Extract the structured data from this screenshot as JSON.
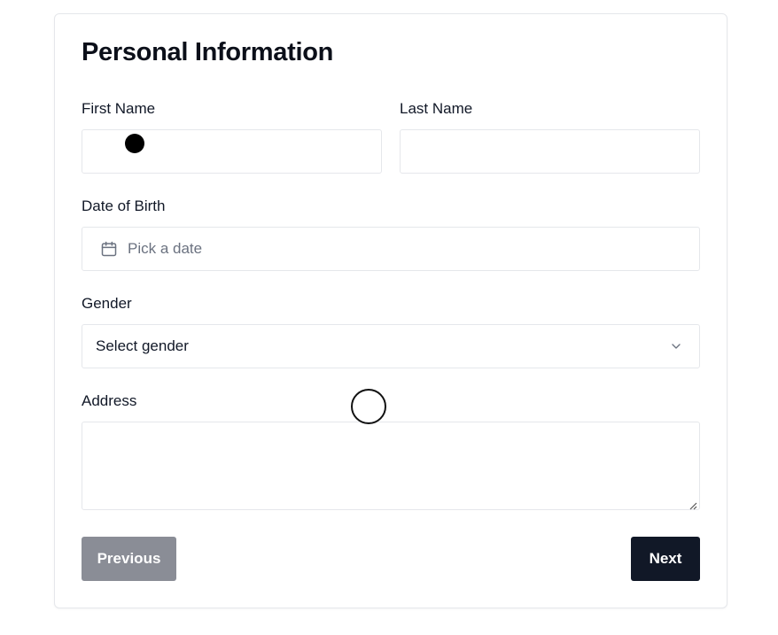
{
  "form": {
    "title": "Personal Information",
    "first_name": {
      "label": "First Name",
      "value": ""
    },
    "last_name": {
      "label": "Last Name",
      "value": ""
    },
    "date_of_birth": {
      "label": "Date of Birth",
      "placeholder": "Pick a date",
      "icon": "calendar-icon"
    },
    "gender": {
      "label": "Gender",
      "selected": "Select gender",
      "icon": "chevron-down-icon"
    },
    "address": {
      "label": "Address",
      "value": ""
    }
  },
  "actions": {
    "previous_label": "Previous",
    "next_label": "Next"
  },
  "colors": {
    "primary": "#111827",
    "disabled": "#8a8d96",
    "border": "#e5e7eb"
  }
}
